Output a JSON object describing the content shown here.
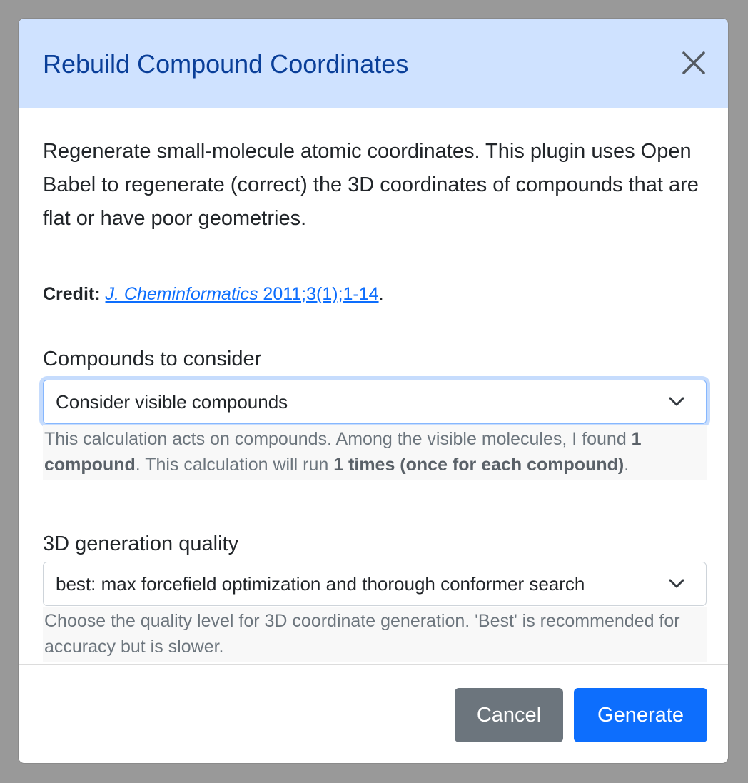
{
  "dialog": {
    "title": "Rebuild Compound Coordinates",
    "close_icon": "close-icon"
  },
  "body": {
    "intro": "Regenerate small-molecule atomic coordinates. This plugin uses Open Babel to regenerate (correct) the 3D coordinates of compounds that are flat or have poor geometries.",
    "credit": {
      "label": "Credit:",
      "link_journal": "J. Cheminformatics",
      "link_rest": " 2011;3(1);1-14",
      "suffix": "."
    }
  },
  "compounds_field": {
    "label": "Compounds to consider",
    "selected": "Consider visible compounds",
    "help": {
      "part1": "This calculation acts on compounds. Among the visible molecules, I found ",
      "count": "1 compound",
      "part2": ". This calculation will run ",
      "runs": "1 times (once for each compound)",
      "part3": "."
    }
  },
  "quality_field": {
    "label": "3D generation quality",
    "selected": "best: max forcefield optimization and thorough conformer search",
    "help": "Choose the quality level for 3D coordinate generation. 'Best' is recommended for accuracy but is slower."
  },
  "footer": {
    "cancel_label": "Cancel",
    "generate_label": "Generate"
  },
  "colors": {
    "header_bg": "#cfe2ff",
    "title": "#0a3f99",
    "primary": "#0d6efd",
    "secondary": "#6c757d",
    "backdrop": "#999999"
  }
}
